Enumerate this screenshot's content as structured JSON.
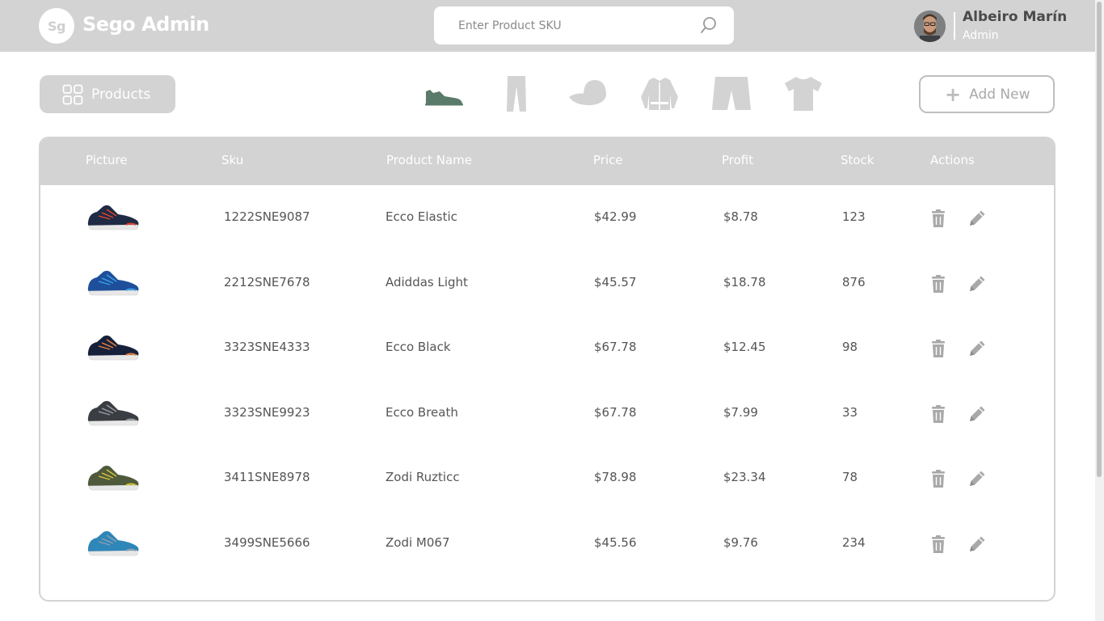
{
  "header": {
    "logo_mark": "Sg",
    "app_title": "Sego Admin",
    "search": {
      "placeholder": "Enter Product SKU",
      "value": ""
    },
    "user": {
      "name": "Albeiro Marín",
      "role": "Admin"
    }
  },
  "toolbar": {
    "products_label": "Products",
    "add_new_label": "Add New",
    "categories": [
      {
        "name": "sneakers",
        "active": true,
        "color": "#5b7b6a"
      },
      {
        "name": "pants",
        "active": false,
        "color": "#d3d3d3"
      },
      {
        "name": "caps",
        "active": false,
        "color": "#d3d3d3"
      },
      {
        "name": "jackets",
        "active": false,
        "color": "#d3d3d3"
      },
      {
        "name": "shorts",
        "active": false,
        "color": "#d3d3d3"
      },
      {
        "name": "t-shirts",
        "active": false,
        "color": "#d3d3d3"
      }
    ]
  },
  "table": {
    "columns": [
      "Picture",
      "Sku",
      "Product Name",
      "Price",
      "Profit",
      "Stock",
      "Actions"
    ],
    "rows": [
      {
        "sku": "1222SNE9087",
        "name": "Ecco Elastic",
        "price": "$42.99",
        "profit": "$8.78",
        "stock": "123",
        "shoe_color": "#1f2a44",
        "accent": "#e0452b"
      },
      {
        "sku": "2212SNE7678",
        "name": "Adiddas Light",
        "price": "$45.57",
        "profit": "$18.78",
        "stock": "876",
        "shoe_color": "#1e4f9a",
        "accent": "#3aa0e8"
      },
      {
        "sku": "3323SNE4333",
        "name": "Ecco Black",
        "price": "$67.78",
        "profit": "$12.45",
        "stock": "98",
        "shoe_color": "#17203a",
        "accent": "#e8813a"
      },
      {
        "sku": "3323SNE9923",
        "name": "Ecco Breath",
        "price": "$67.78",
        "profit": "$7.99",
        "stock": "33",
        "shoe_color": "#3a3d42",
        "accent": "#9a9ea4"
      },
      {
        "sku": "3411SNE8978",
        "name": "Zodi Ruzticc",
        "price": "$78.98",
        "profit": "$23.34",
        "stock": "78",
        "shoe_color": "#4f5a3c",
        "accent": "#d8c23a"
      },
      {
        "sku": "3499SNE5666",
        "name": "Zodi M067",
        "price": "$45.56",
        "profit": "$9.76",
        "stock": "234",
        "shoe_color": "#2f86b8",
        "accent": "#8aa0b0"
      }
    ]
  },
  "colors": {
    "header_bg": "#d3d3d3",
    "active_category": "#5b7b6a",
    "icon_gray": "#bfbfbf",
    "text": "#555555"
  }
}
